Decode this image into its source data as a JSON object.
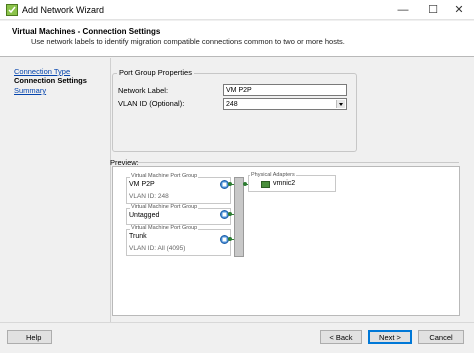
{
  "window": {
    "title": "Add Network Wizard",
    "controls": [
      "—",
      "☐",
      "✕"
    ]
  },
  "header": {
    "title": "Virtual Machines - Connection Settings",
    "subtitle": "Use network labels to identify migration compatible connections common to two or more hosts."
  },
  "sidebar": {
    "steps": [
      {
        "label": "Connection Type",
        "state": "link"
      },
      {
        "label": "Connection Settings",
        "state": "current"
      },
      {
        "label": "Summary",
        "state": "link"
      }
    ]
  },
  "form": {
    "group_title": "Port Group Properties",
    "network_label_label": "Network Label:",
    "network_label_value": "VM P2P",
    "vlan_label": "VLAN ID (Optional):",
    "vlan_value": "248"
  },
  "preview": {
    "label": "Preview:",
    "port_groups": [
      {
        "legend": "Virtual Machine Port Group",
        "name": "VM P2P",
        "vlan": "VLAN ID: 248"
      },
      {
        "legend": "Virtual Machine Port Group",
        "name": "Untagged",
        "vlan": ""
      },
      {
        "legend": "Virtual Machine Port Group",
        "name": "Trunk",
        "vlan": "VLAN ID: All (4095)"
      }
    ],
    "physical_adapters_legend": "Physical Adapters",
    "adapter": "vmnic2"
  },
  "footer": {
    "help": "Help",
    "back": "< Back",
    "next": "Next >",
    "cancel": "Cancel"
  },
  "colors": {
    "link": "#0645ad",
    "connector": "#2e7d32",
    "default_button_border": "#0078d7"
  }
}
